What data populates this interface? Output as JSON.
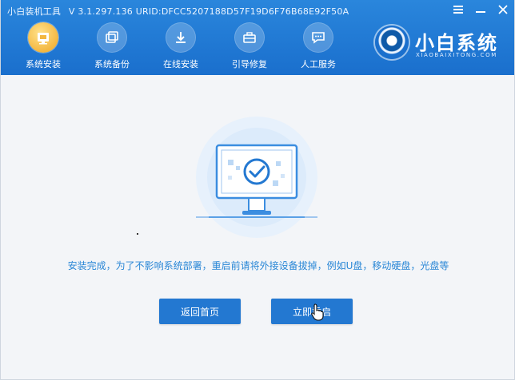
{
  "titlebar": {
    "title": "小白装机工具",
    "version": "V 3.1.297.136",
    "urid": "URID:DFCC5207188D57F19D6F76B68E92F50A"
  },
  "window_controls": [
    {
      "icon": "menu-icon"
    },
    {
      "icon": "minimize-icon"
    },
    {
      "icon": "close-icon"
    }
  ],
  "nav": {
    "items": [
      {
        "label": "系统安装",
        "icon": "system-install-icon",
        "active": true
      },
      {
        "label": "系统备份",
        "icon": "backup-icon",
        "active": false
      },
      {
        "label": "在线安装",
        "icon": "download-icon",
        "active": false
      },
      {
        "label": "引导修复",
        "icon": "toolbox-icon",
        "active": false
      },
      {
        "label": "人工服务",
        "icon": "chat-icon",
        "active": false
      }
    ]
  },
  "brand": {
    "name": "小白系统",
    "subtitle": "XIAOBAIXITONG.COM"
  },
  "main": {
    "illustration": "monitor-check-icon",
    "message": "安装完成，为了不影响系统部署，重启前请将外接设备拔掉，例如U盘，移动硬盘，光盘等",
    "buttons": {
      "home": "返回首页",
      "restart": "立即重启"
    }
  },
  "colors": {
    "header": "#1a6fcd",
    "accent": "#2378d1",
    "message": "#2a87d6",
    "active_nav": "#f3b740"
  }
}
